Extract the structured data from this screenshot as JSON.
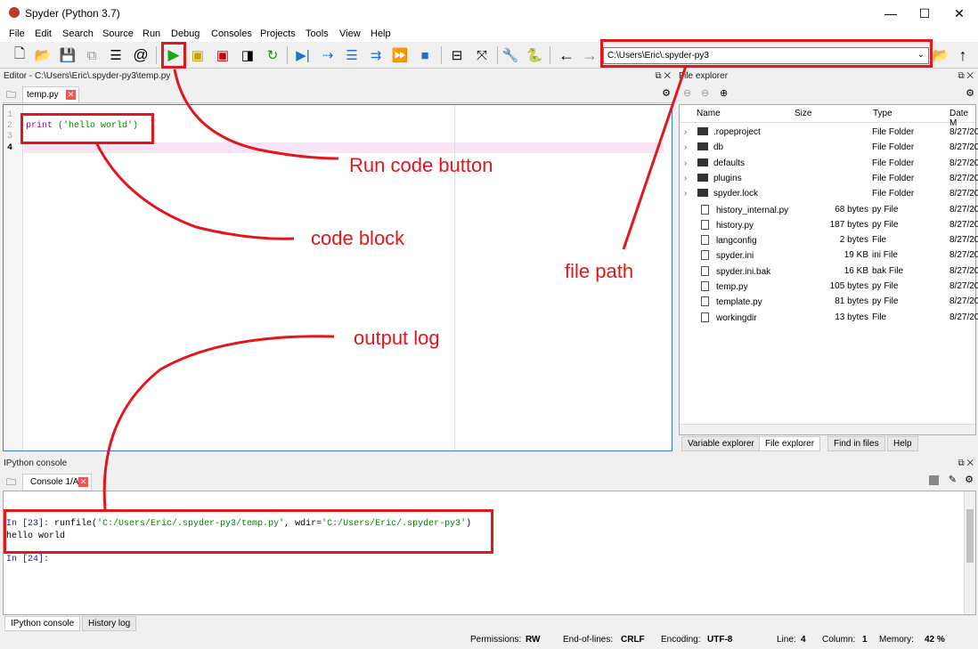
{
  "window": {
    "title": "Spyder (Python 3.7)"
  },
  "menu": [
    "File",
    "Edit",
    "Search",
    "Source",
    "Run",
    "Debug",
    "Consoles",
    "Projects",
    "Tools",
    "View",
    "Help"
  ],
  "toolbar": {
    "path_value": "C:\\Users\\Eric\\.spyder-py3"
  },
  "editor": {
    "header": "Editor - C:\\Users\\Eric\\.spyder-py3\\temp.py",
    "tab": "temp.py",
    "line_numbers": [
      "1",
      "2",
      "3",
      "4"
    ],
    "code_print": "print",
    "code_rest": " ('hello world')"
  },
  "file_explorer": {
    "header": "File explorer",
    "columns": [
      "Name",
      "Size",
      "Type",
      "Date M"
    ],
    "rows": [
      {
        "name": ".ropeproject",
        "size": "",
        "type": "File Folder",
        "date": "8/27/20"
      },
      {
        "name": "db",
        "size": "",
        "type": "File Folder",
        "date": "8/27/20"
      },
      {
        "name": "defaults",
        "size": "",
        "type": "File Folder",
        "date": "8/27/20"
      },
      {
        "name": "plugins",
        "size": "",
        "type": "File Folder",
        "date": "8/27/20"
      },
      {
        "name": "spyder.lock",
        "size": "",
        "type": "File Folder",
        "date": "8/27/20"
      },
      {
        "name": "history_internal.py",
        "size": "68 bytes",
        "type": "py File",
        "date": "8/27/20"
      },
      {
        "name": "history.py",
        "size": "187 bytes",
        "type": "py File",
        "date": "8/27/20"
      },
      {
        "name": "langconfig",
        "size": "2 bytes",
        "type": "File",
        "date": "8/27/20"
      },
      {
        "name": "spyder.ini",
        "size": "19 KB",
        "type": "ini File",
        "date": "8/27/20"
      },
      {
        "name": "spyder.ini.bak",
        "size": "16 KB",
        "type": "bak File",
        "date": "8/27/20"
      },
      {
        "name": "temp.py",
        "size": "105 bytes",
        "type": "py File",
        "date": "8/27/20"
      },
      {
        "name": "template.py",
        "size": "81 bytes",
        "type": "py File",
        "date": "8/27/20"
      },
      {
        "name": "workingdir",
        "size": "13 bytes",
        "type": "File",
        "date": "8/27/20"
      }
    ],
    "bottom_tabs": [
      "Variable explorer",
      "File explorer",
      "Find in files",
      "Help"
    ]
  },
  "console": {
    "header": "IPython console",
    "tab": "Console 1/A",
    "in23_prompt": "In [23]:",
    "in23_cmd": " runfile(",
    "in23_arg1": "'C:/Users/Eric/.spyder-py3/temp.py'",
    "in23_mid": ", wdir=",
    "in23_arg2": "'C:/Users/Eric/.spyder-py3'",
    "in23_end": ")",
    "output": "hello world",
    "in24_prompt": "In [24]:",
    "bottom_tabs": [
      "IPython console",
      "History log"
    ]
  },
  "status": {
    "permissions_label": "Permissions:",
    "permissions": "RW",
    "eol_label": "End-of-lines:",
    "eol": "CRLF",
    "encoding_label": "Encoding:",
    "encoding": "UTF-8",
    "line_label": "Line:",
    "line": "4",
    "column_label": "Column:",
    "column": "1",
    "memory_label": "Memory:",
    "memory": "42 %"
  },
  "annotations": {
    "run": "Run code button",
    "code": "code block",
    "path": "file path",
    "output": "output log"
  },
  "colors": {
    "annotation": "#e3161b",
    "accent": "#3a7dd8"
  }
}
